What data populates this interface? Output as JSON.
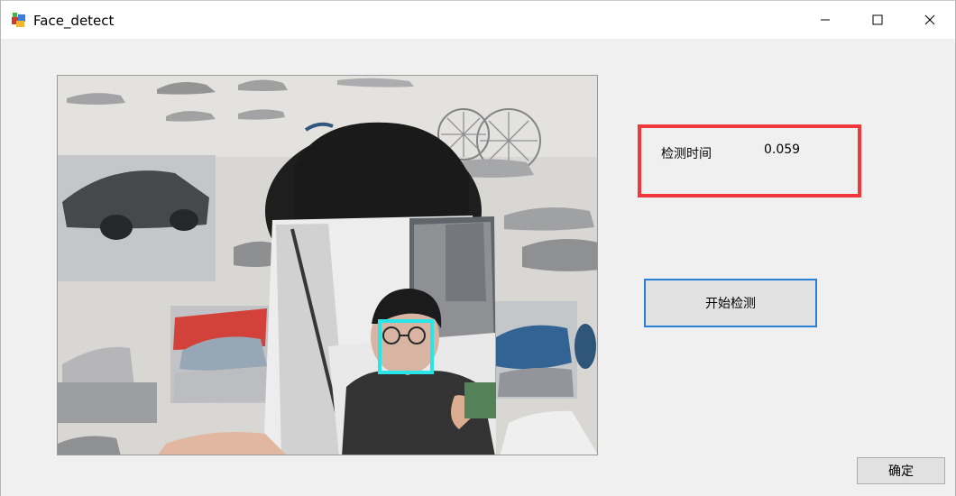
{
  "window": {
    "title": "Face_detect"
  },
  "controls": {
    "minimize_icon": "minimize-icon",
    "maximize_icon": "maximize-icon",
    "close_icon": "close-icon"
  },
  "info": {
    "label": "检测时间",
    "value": "0.059"
  },
  "buttons": {
    "start_label": "开始检测",
    "ok_label": "确定"
  },
  "colors": {
    "info_border": "#f0383c",
    "start_button_border": "#2b7fd0",
    "face_box": "#22e4e6"
  }
}
